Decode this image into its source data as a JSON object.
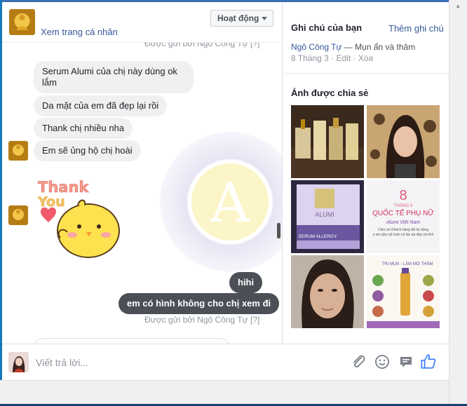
{
  "header": {
    "profile_link": "Xem trang cá nhân",
    "status_button": "Hoạt động"
  },
  "conversation": {
    "sent_by_top": "Được gửi bởi Ngô Công Tự [?]",
    "incoming": [
      "Serum Alumi của chị này dùng ok lắm",
      "Da mặt của em đã đẹp lại rồi",
      "Thank chị nhiều nha",
      "Em sẽ ủng hộ chị hoài"
    ],
    "sticker_text": [
      "Thank",
      "You"
    ],
    "watermark_letter": "A",
    "outgoing": [
      "hihi",
      "em có hình không cho chị xem đi"
    ],
    "sent_by_bottom": "Được gửi bởi Ngô Công Tự [?]"
  },
  "composer": {
    "placeholder": "Viết trả lời...",
    "icons": [
      "paperclip-icon",
      "emoji-icon",
      "sticker-icon",
      "like-icon"
    ]
  },
  "sidebar": {
    "notes_title": "Ghi chú của bạn",
    "add_note": "Thêm ghi chú",
    "note_author": "Ngô Công Tự",
    "note_text": " — Mụn ẩn và thâm",
    "note_meta": "8 Tháng 3 · Edit · Xóa",
    "shared_title": "Ảnh được chia sẻ",
    "photos": [
      {
        "name": "product-photo"
      },
      {
        "name": "selfie-photo"
      },
      {
        "name": "serum-box-photo",
        "brand": "ALUMI",
        "product": "SERUM ALLERGY"
      },
      {
        "name": "womens-day-photo",
        "day": "8",
        "month": "THÁNG 3",
        "title": "QUỐC TẾ PHỤ NỮ",
        "brand": "Alumi Việt Nam",
        "line1": "Cảm ơn Khách hàng đã tin dùng",
        "line2": "y em phụ nữ luôn có làn da đẹp và khỏ"
      },
      {
        "name": "face-photo"
      },
      {
        "name": "acne-treatment-photo",
        "header": "TRỊ MỤN - LÀM MỜ THÂM"
      }
    ]
  },
  "colors": {
    "link": "#365899",
    "outgoing_bubble": "#4b4f56",
    "incoming_bubble": "#f1f0f0",
    "like_blue": "#4080ff"
  }
}
